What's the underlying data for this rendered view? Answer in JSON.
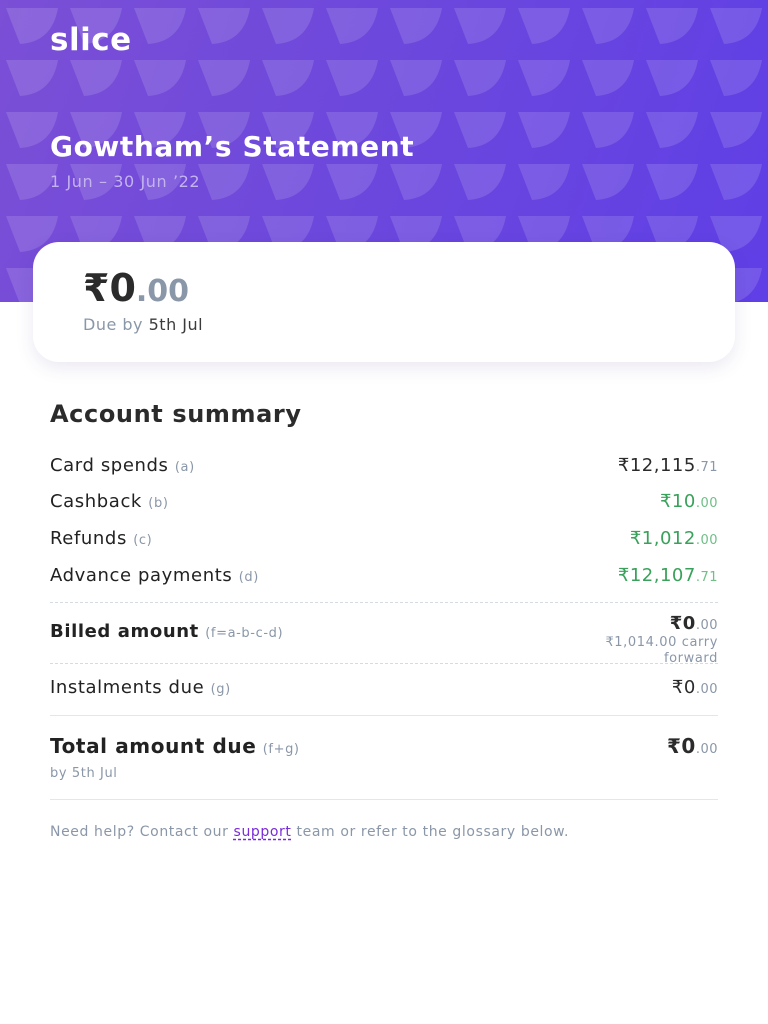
{
  "header": {
    "logo": "slice",
    "title": "Gowtham’s Statement",
    "period": "1 Jun – 30 Jun ’22"
  },
  "due_card": {
    "currency": "₹",
    "amount_int": "0",
    "amount_dec": ".00",
    "due_label": "Due by",
    "due_date": "5th Jul"
  },
  "summary": {
    "title": "Account summary",
    "rows": [
      {
        "label": "Card spends",
        "hint": "(a)",
        "currency": "₹",
        "int": "12,115",
        "dec": ".71"
      },
      {
        "label": "Cashback",
        "hint": "(b)",
        "currency": "₹",
        "int": "10",
        "dec": ".00"
      },
      {
        "label": "Refunds",
        "hint": "(c)",
        "currency": "₹",
        "int": "1,012",
        "dec": ".00"
      },
      {
        "label": "Advance payments",
        "hint": "(d)",
        "currency": "₹",
        "int": "12,107",
        "dec": ".71"
      }
    ],
    "billed": {
      "label": "Billed amount",
      "hint": "(f=a-b-c-d)",
      "currency": "₹",
      "int": "0",
      "dec": ".00",
      "note": "₹1,014.00 carry forward"
    },
    "instalments": {
      "label": "Instalments due",
      "hint": "(g)",
      "currency": "₹",
      "int": "0",
      "dec": ".00"
    },
    "total": {
      "label": "Total amount due",
      "hint": "(f+g)",
      "currency": "₹",
      "int": "0",
      "dec": ".00",
      "sub": "by 5th Jul"
    }
  },
  "help": {
    "before": "Need help? Contact our ",
    "link": "support",
    "after": " team or refer to the glossary below."
  },
  "colors": {
    "brand_purple": "#6d48dc",
    "credit_green": "#3aa15b",
    "link_purple": "#7a2bd8"
  }
}
